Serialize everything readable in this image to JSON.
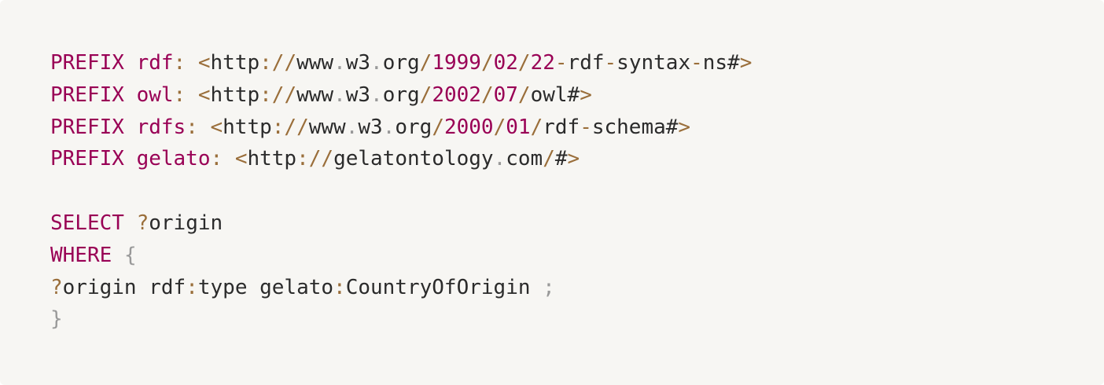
{
  "colors": {
    "background": "#f7f6f3",
    "keyword": "#990055",
    "punctuation": "#9a6e3a",
    "text": "#2b2b2b",
    "operator": "#999999"
  },
  "code": {
    "lines": [
      [
        {
          "t": "kw",
          "v": "PREFIX rdf"
        },
        {
          "t": "p",
          "v": ":"
        },
        {
          "t": "x",
          "v": " "
        },
        {
          "t": "p",
          "v": "<"
        },
        {
          "t": "x",
          "v": "http"
        },
        {
          "t": "p",
          "v": "://"
        },
        {
          "t": "x",
          "v": "www"
        },
        {
          "t": "o",
          "v": "."
        },
        {
          "t": "x",
          "v": "w3"
        },
        {
          "t": "o",
          "v": "."
        },
        {
          "t": "x",
          "v": "org"
        },
        {
          "t": "p",
          "v": "/"
        },
        {
          "t": "kw",
          "v": "1999"
        },
        {
          "t": "p",
          "v": "/"
        },
        {
          "t": "kw",
          "v": "02"
        },
        {
          "t": "p",
          "v": "/"
        },
        {
          "t": "kw",
          "v": "22"
        },
        {
          "t": "p",
          "v": "-"
        },
        {
          "t": "x",
          "v": "rdf"
        },
        {
          "t": "p",
          "v": "-"
        },
        {
          "t": "x",
          "v": "syntax"
        },
        {
          "t": "p",
          "v": "-"
        },
        {
          "t": "x",
          "v": "ns#"
        },
        {
          "t": "p",
          "v": ">"
        }
      ],
      [
        {
          "t": "kw",
          "v": "PREFIX owl"
        },
        {
          "t": "p",
          "v": ":"
        },
        {
          "t": "x",
          "v": " "
        },
        {
          "t": "p",
          "v": "<"
        },
        {
          "t": "x",
          "v": "http"
        },
        {
          "t": "p",
          "v": "://"
        },
        {
          "t": "x",
          "v": "www"
        },
        {
          "t": "o",
          "v": "."
        },
        {
          "t": "x",
          "v": "w3"
        },
        {
          "t": "o",
          "v": "."
        },
        {
          "t": "x",
          "v": "org"
        },
        {
          "t": "p",
          "v": "/"
        },
        {
          "t": "kw",
          "v": "2002"
        },
        {
          "t": "p",
          "v": "/"
        },
        {
          "t": "kw",
          "v": "07"
        },
        {
          "t": "p",
          "v": "/"
        },
        {
          "t": "x",
          "v": "owl#"
        },
        {
          "t": "p",
          "v": ">"
        }
      ],
      [
        {
          "t": "kw",
          "v": "PREFIX rdfs"
        },
        {
          "t": "p",
          "v": ":"
        },
        {
          "t": "x",
          "v": " "
        },
        {
          "t": "p",
          "v": "<"
        },
        {
          "t": "x",
          "v": "http"
        },
        {
          "t": "p",
          "v": "://"
        },
        {
          "t": "x",
          "v": "www"
        },
        {
          "t": "o",
          "v": "."
        },
        {
          "t": "x",
          "v": "w3"
        },
        {
          "t": "o",
          "v": "."
        },
        {
          "t": "x",
          "v": "org"
        },
        {
          "t": "p",
          "v": "/"
        },
        {
          "t": "kw",
          "v": "2000"
        },
        {
          "t": "p",
          "v": "/"
        },
        {
          "t": "kw",
          "v": "01"
        },
        {
          "t": "p",
          "v": "/"
        },
        {
          "t": "x",
          "v": "rdf"
        },
        {
          "t": "p",
          "v": "-"
        },
        {
          "t": "x",
          "v": "schema#"
        },
        {
          "t": "p",
          "v": ">"
        }
      ],
      [
        {
          "t": "kw",
          "v": "PREFIX gelato"
        },
        {
          "t": "p",
          "v": ":"
        },
        {
          "t": "x",
          "v": " "
        },
        {
          "t": "p",
          "v": "<"
        },
        {
          "t": "x",
          "v": "http"
        },
        {
          "t": "p",
          "v": "://"
        },
        {
          "t": "x",
          "v": "gelatontology"
        },
        {
          "t": "o",
          "v": "."
        },
        {
          "t": "x",
          "v": "com"
        },
        {
          "t": "p",
          "v": "/"
        },
        {
          "t": "x",
          "v": "#"
        },
        {
          "t": "p",
          "v": ">"
        }
      ],
      [],
      [
        {
          "t": "kw",
          "v": "SELECT"
        },
        {
          "t": "x",
          "v": " "
        },
        {
          "t": "p",
          "v": "?"
        },
        {
          "t": "x",
          "v": "origin"
        }
      ],
      [
        {
          "t": "kw",
          "v": "WHERE"
        },
        {
          "t": "x",
          "v": " "
        },
        {
          "t": "o",
          "v": "{"
        }
      ],
      [
        {
          "t": "p",
          "v": "?"
        },
        {
          "t": "x",
          "v": "origin rdf"
        },
        {
          "t": "p",
          "v": ":"
        },
        {
          "t": "x",
          "v": "type gelato"
        },
        {
          "t": "p",
          "v": ":"
        },
        {
          "t": "x",
          "v": "CountryOfOrigin "
        },
        {
          "t": "o",
          "v": ";"
        }
      ],
      [
        {
          "t": "o",
          "v": "}"
        }
      ]
    ]
  }
}
